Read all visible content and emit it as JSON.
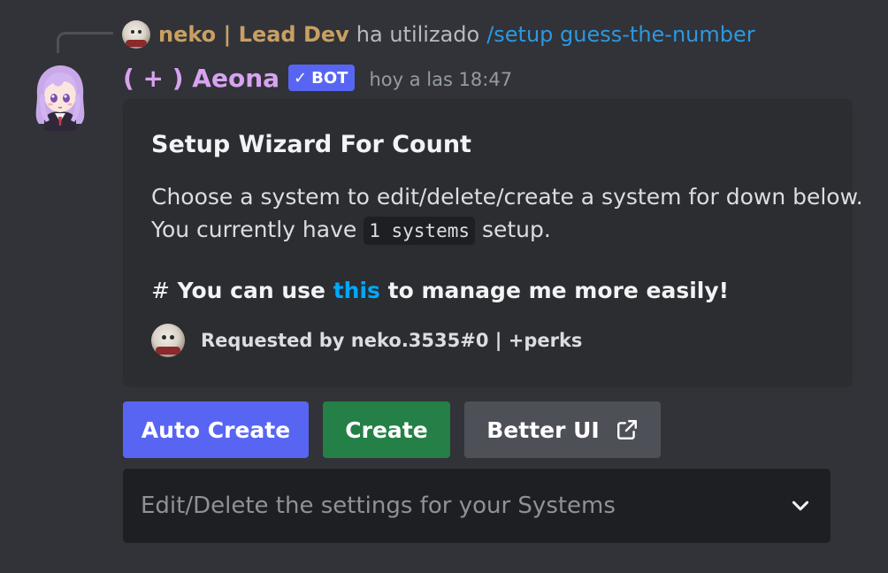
{
  "reply": {
    "author": "neko | Lead Dev",
    "text": "ha utilizado",
    "command": "/setup guess-the-number"
  },
  "message": {
    "username": "( + ) Aeona",
    "bot_tag": "BOT",
    "bot_check_icon": "check-icon",
    "timestamp": "hoy a las 18:47"
  },
  "embed": {
    "title": "Setup Wizard For Count",
    "desc_line1": "Choose a system to edit/delete/create a system for down below.",
    "desc_line2_prefix": "You currently have",
    "desc_code": "1 systems",
    "desc_line2_suffix": "setup.",
    "heading_hash": "#",
    "heading_pre": "You can use",
    "heading_link": "this",
    "heading_post": "to manage me more easily!",
    "footer_text": "Requested by neko.3535#0 | +perks"
  },
  "buttons": {
    "auto_create": "Auto Create",
    "create": "Create",
    "better_ui": "Better UI",
    "better_ui_icon": "external-link-icon"
  },
  "select": {
    "placeholder": "Edit/Delete the settings for your Systems",
    "icon": "chevron-down-icon"
  },
  "colors": {
    "background": "#313338",
    "embed_bg": "#2b2d31",
    "blurple": "#5865f2",
    "green": "#248046",
    "grey_button": "#4e5058",
    "username": "#d8a3f0",
    "reply_author": "#c9a063",
    "command": "#2c98e0",
    "link": "#00a8fc"
  }
}
